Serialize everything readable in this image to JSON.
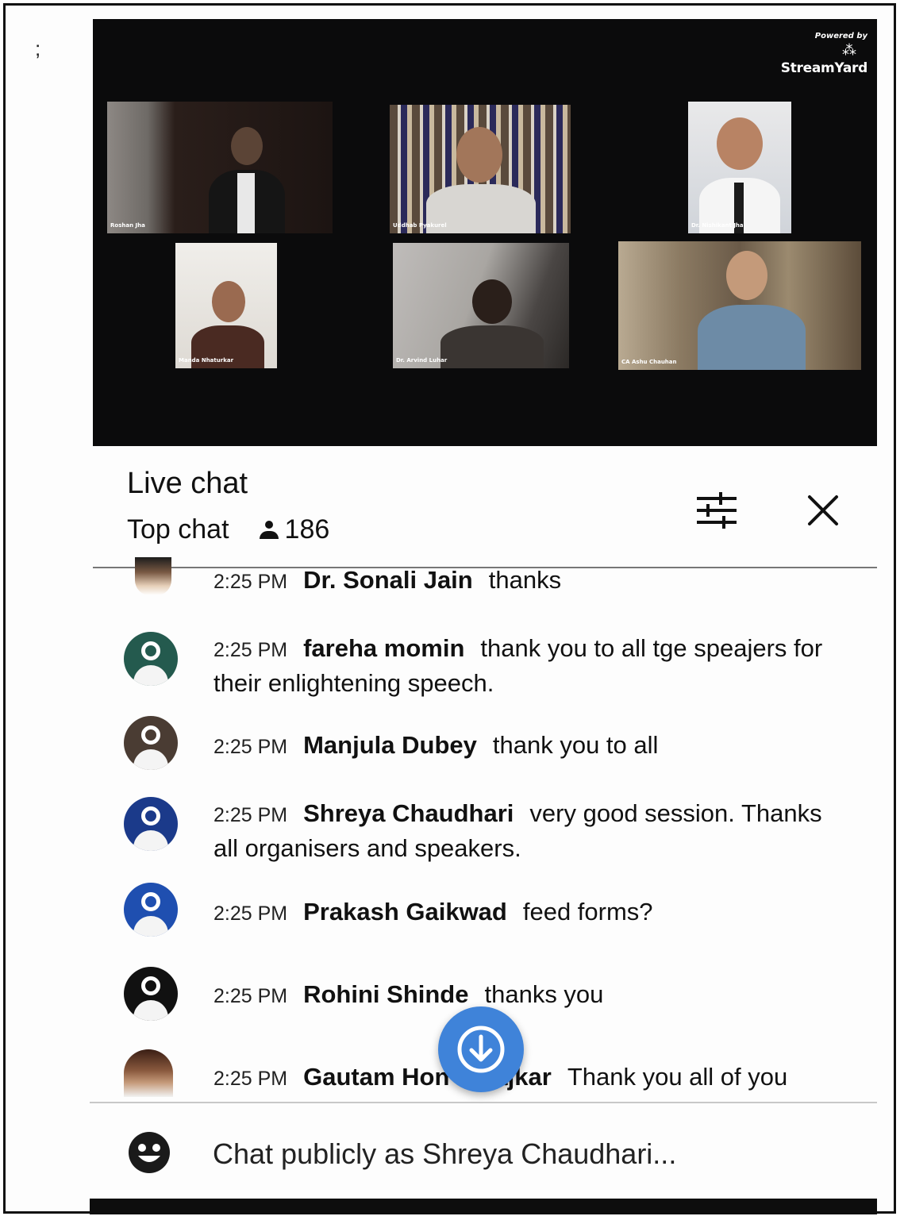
{
  "stream": {
    "powered_by": "Powered by",
    "brand": "StreamYard",
    "participants": [
      {
        "name": "Roshan Jha"
      },
      {
        "name": "Uddhab Pyakurel"
      },
      {
        "name": "Dr. Nishikant Jha"
      },
      {
        "name": "Manda Nhaturkar"
      },
      {
        "name": "Dr. Arvind Luhar"
      },
      {
        "name": "CA Ashu Chauhan"
      }
    ]
  },
  "chat": {
    "title": "Live chat",
    "mode": "Top chat",
    "viewer_count": "186",
    "messages": [
      {
        "time": "2:25 PM",
        "author": "Dr. Sonali Jain",
        "text": "thanks",
        "avatar_color": "#c9a98a"
      },
      {
        "time": "2:25 PM",
        "author": "fareha momin",
        "text": "thank you to all tge speajers for their enlightening speech.",
        "avatar_color": "#245a4e"
      },
      {
        "time": "2:25 PM",
        "author": "Manjula Dubey",
        "text": "thank you to all",
        "avatar_color": "#4a3c33"
      },
      {
        "time": "2:25 PM",
        "author": "Shreya Chaudhari",
        "text": "very good session. Thanks all organisers and speakers.",
        "avatar_color": "#1b3a8a"
      },
      {
        "time": "2:25 PM",
        "author": "Prakash Gaikwad",
        "text": "feed forms?",
        "avatar_color": "#1f4fb0"
      },
      {
        "time": "2:25 PM",
        "author": "Rohini Shinde",
        "text": "thanks you",
        "avatar_color": "#111111"
      },
      {
        "time": "2:25 PM",
        "author": "Gautam Hon",
        "author_tail": "ajkar",
        "text": "Thank you all of you",
        "avatar_color": "#6a3b2a"
      }
    ],
    "input_placeholder": "Chat publicly as Shreya Chaudhari..."
  },
  "colors": {
    "accent_blue": "#3f83d9",
    "video_bg": "#0b0b0c"
  }
}
